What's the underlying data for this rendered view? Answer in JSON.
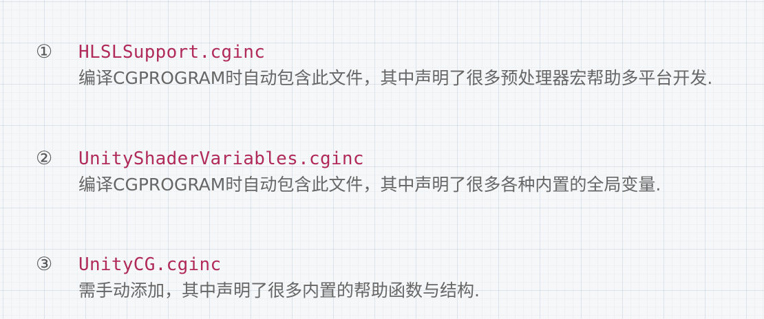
{
  "entries": [
    {
      "marker": "①",
      "filename": "HLSLSupport.cginc",
      "description": "编译CGPROGRAM时自动包含此文件，其中声明了很多预处理器宏帮助多平台开发."
    },
    {
      "marker": "②",
      "filename": "UnityShaderVariables.cginc",
      "description": "编译CGPROGRAM时自动包含此文件，其中声明了很多各种内置的全局变量."
    },
    {
      "marker": "③",
      "filename": "UnityCG.cginc",
      "description": "需手动添加，其中声明了很多内置的帮助函数与结构."
    }
  ],
  "colors": {
    "filename": "#b02a5a",
    "text": "#666666",
    "background": "#f6f7f8"
  }
}
